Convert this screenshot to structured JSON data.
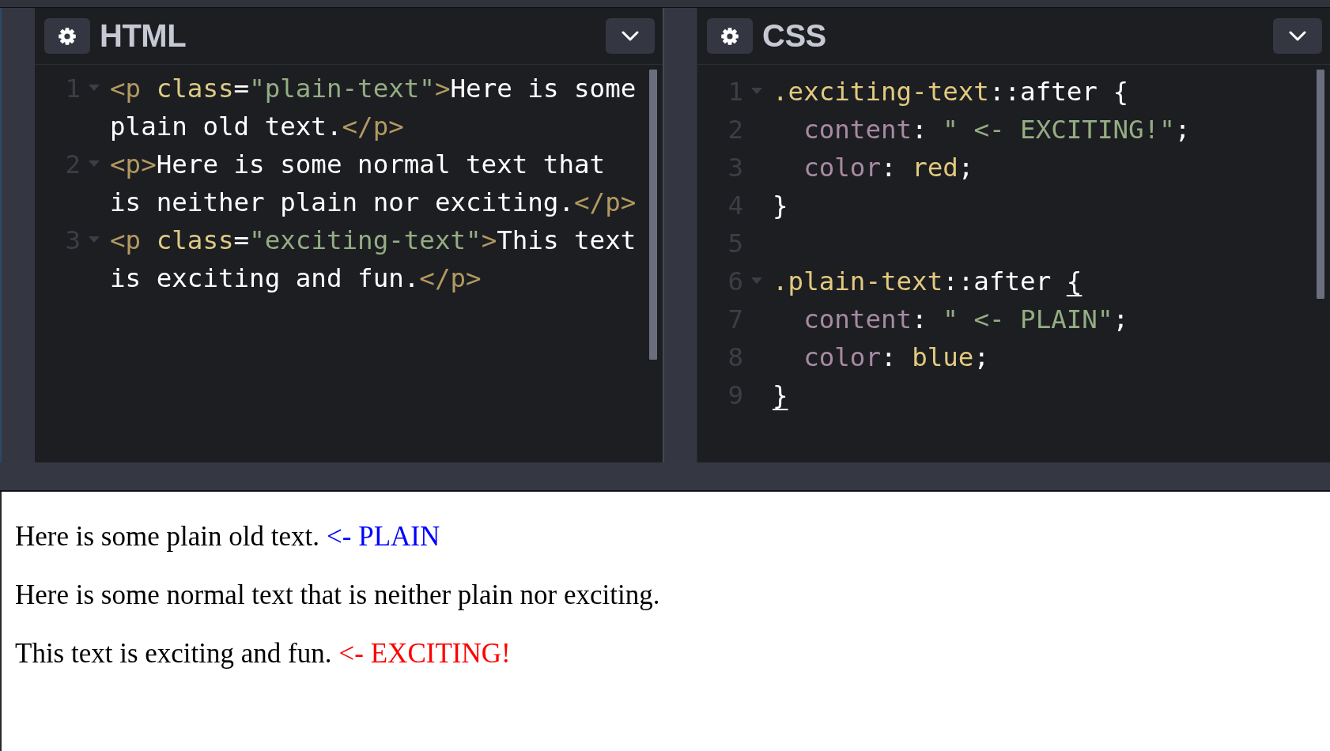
{
  "panels": [
    {
      "title": "HTML",
      "lines": [
        {
          "number": "1",
          "foldable": true,
          "tokens": [
            {
              "kind": "tag",
              "text": "<p"
            },
            {
              "kind": "attr",
              "text": " class"
            },
            {
              "kind": "punct",
              "text": "="
            },
            {
              "kind": "string",
              "text": "\"plain-text\""
            },
            {
              "kind": "tag",
              "text": ">"
            },
            {
              "kind": "text",
              "text": "Here is some plain old text."
            },
            {
              "kind": "tag",
              "text": "</p>"
            }
          ]
        },
        {
          "number": "2",
          "foldable": true,
          "tokens": [
            {
              "kind": "tag",
              "text": "<p>"
            },
            {
              "kind": "text",
              "text": "Here is some normal text that is neither plain nor exciting."
            },
            {
              "kind": "tag",
              "text": "</p>"
            }
          ]
        },
        {
          "number": "3",
          "foldable": true,
          "tokens": [
            {
              "kind": "tag",
              "text": "<p"
            },
            {
              "kind": "attr",
              "text": " class"
            },
            {
              "kind": "punct",
              "text": "="
            },
            {
              "kind": "string",
              "text": "\"exciting-text\""
            },
            {
              "kind": "tag",
              "text": ">"
            },
            {
              "kind": "text",
              "text": "This text is exciting and fun."
            },
            {
              "kind": "tag",
              "text": "</p>"
            }
          ]
        }
      ]
    },
    {
      "title": "CSS",
      "lines": [
        {
          "number": "1",
          "foldable": true,
          "tokens": [
            {
              "kind": "selector",
              "text": ".exciting-text"
            },
            {
              "kind": "punct",
              "text": "::after {"
            }
          ]
        },
        {
          "number": "2",
          "foldable": false,
          "tokens": [
            {
              "kind": "property",
              "text": "  content"
            },
            {
              "kind": "punct",
              "text": ": "
            },
            {
              "kind": "string",
              "text": "\" <- EXCITING!\""
            },
            {
              "kind": "punct",
              "text": ";"
            }
          ]
        },
        {
          "number": "3",
          "foldable": false,
          "tokens": [
            {
              "kind": "property",
              "text": "  color"
            },
            {
              "kind": "punct",
              "text": ": "
            },
            {
              "kind": "value",
              "text": "red"
            },
            {
              "kind": "punct",
              "text": ";"
            }
          ]
        },
        {
          "number": "4",
          "foldable": false,
          "tokens": [
            {
              "kind": "punct",
              "text": "}"
            }
          ]
        },
        {
          "number": "5",
          "foldable": false
        },
        {
          "number": "6",
          "foldable": true,
          "tokens": [
            {
              "kind": "selector",
              "text": ".plain-text"
            },
            {
              "kind": "punct",
              "text": "::after "
            },
            {
              "kind": "brace_match",
              "text": "{"
            }
          ]
        },
        {
          "number": "7",
          "foldable": false,
          "tokens": [
            {
              "kind": "property",
              "text": "  content"
            },
            {
              "kind": "punct",
              "text": ": "
            },
            {
              "kind": "string",
              "text": "\" <- PLAIN\""
            },
            {
              "kind": "punct",
              "text": ";"
            }
          ]
        },
        {
          "number": "8",
          "foldable": false,
          "tokens": [
            {
              "kind": "property",
              "text": "  color"
            },
            {
              "kind": "punct",
              "text": ": "
            },
            {
              "kind": "value",
              "text": "blue"
            },
            {
              "kind": "punct",
              "text": ";"
            }
          ]
        },
        {
          "number": "9",
          "foldable": false,
          "tokens": [
            {
              "kind": "brace_match",
              "text": "}"
            }
          ]
        }
      ]
    }
  ],
  "preview": {
    "paragraphs": [
      {
        "text": "Here is some plain old text.",
        "after": {
          "text": "<- PLAIN",
          "color": "#0000ff"
        }
      },
      {
        "text": "Here is some normal text that is neither plain nor exciting."
      },
      {
        "text": "This text is exciting and fun.",
        "after": {
          "text": "<- EXCITING!",
          "color": "#ff0000"
        }
      }
    ]
  }
}
